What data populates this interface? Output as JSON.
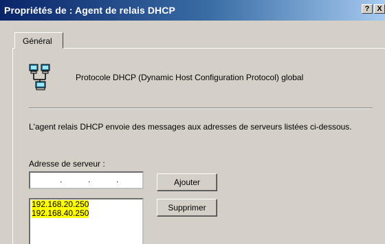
{
  "window": {
    "title": "Propriétés de : Agent de relais DHCP",
    "help_label": "?",
    "close_label": "X"
  },
  "tabs": [
    {
      "label": "Général"
    }
  ],
  "protocol": {
    "icon": "network-computers-icon",
    "label": "Protocole DHCP (Dynamic Host Configuration Protocol) global"
  },
  "description": "L'agent relais DHCP envoie des messages aux adresses de serveurs listées ci-dessous.",
  "server_address": {
    "label": "Adresse de serveur :",
    "input_value": ""
  },
  "buttons": {
    "add": "Ajouter",
    "remove": "Supprimer"
  },
  "servers": [
    "192.168.20.250",
    "192.168.40.250"
  ],
  "colors": {
    "title_start": "#0a246a",
    "title_end": "#a6caf0",
    "highlight": "#ffff00",
    "face": "#d4d0c8"
  }
}
